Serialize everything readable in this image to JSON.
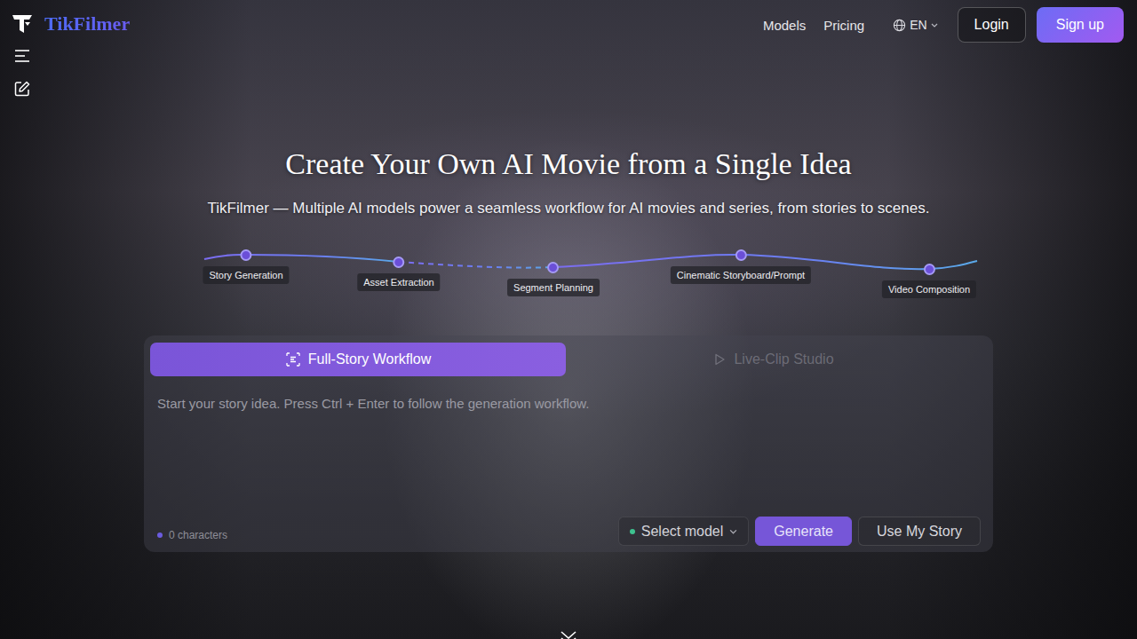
{
  "brand": {
    "name": "TikFilmer"
  },
  "nav": {
    "links": [
      "Models",
      "Pricing"
    ],
    "language": "EN",
    "login": "Login",
    "signup": "Sign up"
  },
  "hero": {
    "title": "Create Your Own AI Movie from a Single Idea",
    "subtitle": "TikFilmer — Multiple AI models power a seamless workflow for AI movies and series, from stories to scenes."
  },
  "workflow": {
    "steps": [
      "Story Generation",
      "Asset Extraction",
      "Segment Planning",
      "Cinematic Storyboard/Prompt",
      "Video Composition"
    ]
  },
  "composer": {
    "tabs": [
      {
        "label": "Full-Story Workflow",
        "selected": true
      },
      {
        "label": "Live-Clip Studio",
        "selected": false
      }
    ],
    "placeholder": "Start your story idea. Press Ctrl + Enter to follow the generation workflow.",
    "char_count": "0 characters",
    "model_select": "Select model",
    "buttons": [
      "Generate",
      "Use My Story"
    ]
  }
}
